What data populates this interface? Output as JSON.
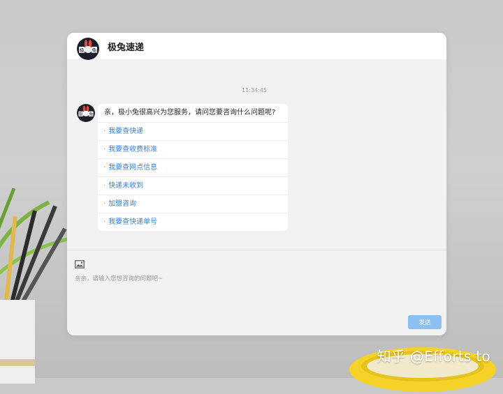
{
  "chat": {
    "title": "极兔速递",
    "timestamp": "11:34:45",
    "greeting": "亲，极小兔很高兴为您服务，请问您要咨询什么问题呢?",
    "options": [
      "我要查快递",
      "我要查收费标准",
      "我要查网点信息",
      "快递未收到",
      "加盟咨询",
      "我要查快递单号"
    ],
    "input_placeholder": "亲亲，请输入您想咨询的问题吧~",
    "send_label": "发送"
  },
  "avatar_text": {
    "left": "极",
    "right": "兔"
  },
  "watermark": "知乎 @Efforts to",
  "colors": {
    "link": "#3a7fd0",
    "send_button": "#8cc0f3",
    "window_bg": "#f2f2f2",
    "header_bg": "#ffffff",
    "avatar_bg": "#1c1c2a",
    "avatar_accent": "#e04b3c"
  },
  "icons": {
    "avatar": "rabbit-logo-icon",
    "image_upload": "image-icon"
  }
}
